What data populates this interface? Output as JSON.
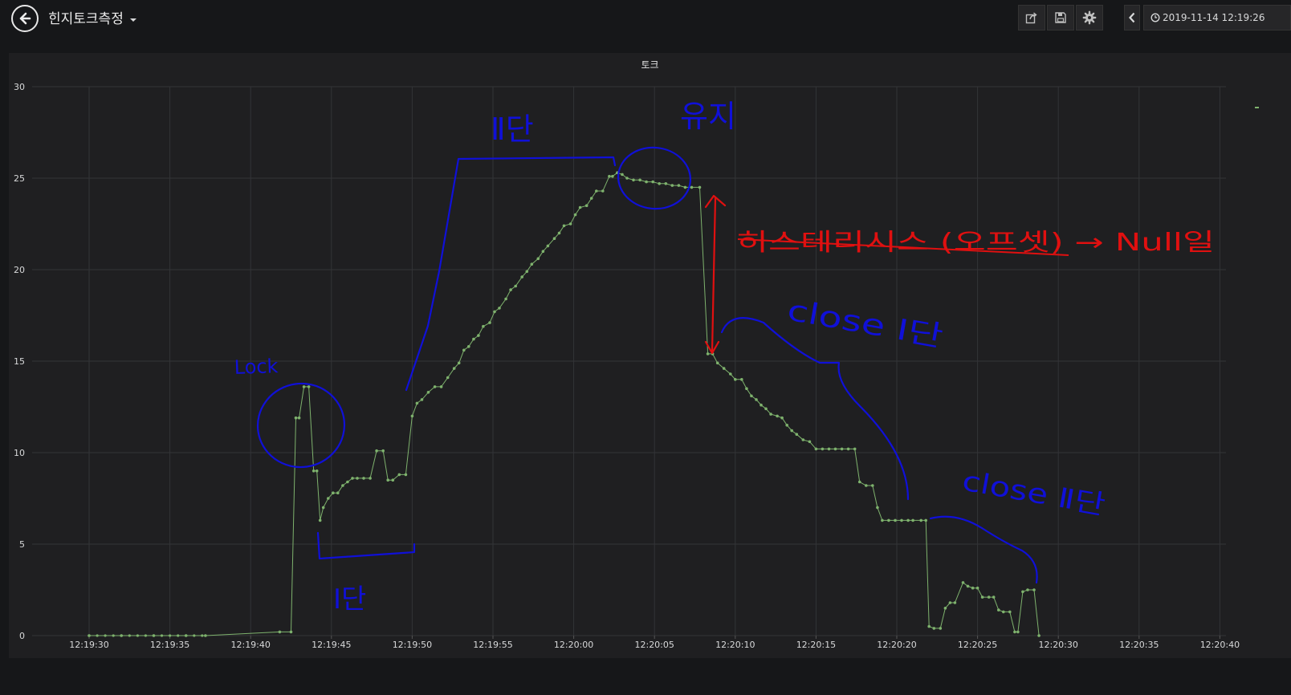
{
  "header": {
    "dashboard_title": "힌지토크측정",
    "time_range": "2019-11-14 12:19:26"
  },
  "icons": {
    "back": "arrow-left-circle-icon",
    "share": "share-icon",
    "save": "save-icon",
    "settings": "gear-icon",
    "time_back": "chevron-left-icon",
    "clock": "clock-icon"
  },
  "colors": {
    "series": "#7eb26d",
    "annotation_blue": "#1010d8",
    "annotation_red": "#e01010",
    "grid": "#333437"
  },
  "panel": {
    "title": "토크"
  },
  "chart_data": {
    "type": "line",
    "title": "토크",
    "ylim": [
      0,
      30
    ],
    "y_ticks": [
      "0",
      "5",
      "10",
      "15",
      "20",
      "25",
      "30"
    ],
    "x_ticks": [
      "12:19:30",
      "12:19:35",
      "12:19:40",
      "12:19:45",
      "12:19:50",
      "12:19:55",
      "12:20:00",
      "12:20:05",
      "12:20:10",
      "12:20:15",
      "12:20:20",
      "12:20:25",
      "12:20:30",
      "12:20:35",
      "12:20:40"
    ],
    "grid": true,
    "series": [
      {
        "name": "",
        "color": "#7eb26d",
        "points": [
          [
            "12:19:30.0",
            0
          ],
          [
            "12:19:32.0",
            0
          ],
          [
            "12:19:34.0",
            0
          ],
          [
            "12:19:36.0",
            0
          ],
          [
            "12:19:37.2",
            0
          ],
          [
            "12:19:41.8",
            0.2
          ],
          [
            "12:19:42.5",
            0.2
          ],
          [
            "12:19:42.8",
            11.9
          ],
          [
            "12:19:43.0",
            11.9
          ],
          [
            "12:19:43.3",
            13.6
          ],
          [
            "12:19:43.6",
            13.6
          ],
          [
            "12:19:43.9",
            9.0
          ],
          [
            "12:19:44.1",
            9.0
          ],
          [
            "12:19:44.3",
            6.3
          ],
          [
            "12:19:44.5",
            7.0
          ],
          [
            "12:19:44.8",
            7.5
          ],
          [
            "12:19:45.1",
            7.8
          ],
          [
            "12:19:45.4",
            7.8
          ],
          [
            "12:19:45.7",
            8.2
          ],
          [
            "12:19:46.0",
            8.4
          ],
          [
            "12:19:46.3",
            8.6
          ],
          [
            "12:19:46.6",
            8.6
          ],
          [
            "12:19:47.0",
            8.6
          ],
          [
            "12:19:47.4",
            8.6
          ],
          [
            "12:19:47.8",
            10.1
          ],
          [
            "12:19:48.2",
            10.1
          ],
          [
            "12:19:48.5",
            8.5
          ],
          [
            "12:19:48.8",
            8.5
          ],
          [
            "12:19:49.2",
            8.8
          ],
          [
            "12:19:49.6",
            8.8
          ],
          [
            "12:19:50.0",
            12.0
          ],
          [
            "12:19:50.3",
            12.7
          ],
          [
            "12:19:50.6",
            12.9
          ],
          [
            "12:19:51.0",
            13.3
          ],
          [
            "12:19:51.4",
            13.6
          ],
          [
            "12:19:51.8",
            13.6
          ],
          [
            "12:19:52.2",
            14.1
          ],
          [
            "12:19:52.6",
            14.6
          ],
          [
            "12:19:52.9",
            14.9
          ],
          [
            "12:19:53.2",
            15.6
          ],
          [
            "12:19:53.5",
            15.8
          ],
          [
            "12:19:53.8",
            16.2
          ],
          [
            "12:19:54.1",
            16.4
          ],
          [
            "12:19:54.4",
            16.9
          ],
          [
            "12:19:54.8",
            17.1
          ],
          [
            "12:19:55.1",
            17.7
          ],
          [
            "12:19:55.4",
            17.9
          ],
          [
            "12:19:55.8",
            18.4
          ],
          [
            "12:19:56.1",
            18.9
          ],
          [
            "12:19:56.4",
            19.1
          ],
          [
            "12:19:56.8",
            19.6
          ],
          [
            "12:19:57.1",
            19.9
          ],
          [
            "12:19:57.4",
            20.3
          ],
          [
            "12:19:57.8",
            20.6
          ],
          [
            "12:19:58.1",
            21.0
          ],
          [
            "12:19:58.4",
            21.3
          ],
          [
            "12:19:58.8",
            21.7
          ],
          [
            "12:19:59.1",
            22.0
          ],
          [
            "12:19:59.4",
            22.4
          ],
          [
            "12:19:59.8",
            22.5
          ],
          [
            "12:20:00.1",
            23.0
          ],
          [
            "12:20:00.4",
            23.4
          ],
          [
            "12:20:00.8",
            23.5
          ],
          [
            "12:20:01.1",
            23.9
          ],
          [
            "12:20:01.4",
            24.3
          ],
          [
            "12:20:01.8",
            24.3
          ],
          [
            "12:20:02.2",
            25.1
          ],
          [
            "12:20:02.4",
            25.1
          ],
          [
            "12:20:02.7",
            25.3
          ],
          [
            "12:20:03.0",
            25.2
          ],
          [
            "12:20:03.3",
            25.0
          ],
          [
            "12:20:03.7",
            24.9
          ],
          [
            "12:20:04.1",
            24.9
          ],
          [
            "12:20:04.5",
            24.8
          ],
          [
            "12:20:04.9",
            24.8
          ],
          [
            "12:20:05.3",
            24.7
          ],
          [
            "12:20:05.7",
            24.7
          ],
          [
            "12:20:06.1",
            24.6
          ],
          [
            "12:20:06.5",
            24.6
          ],
          [
            "12:20:06.9",
            24.5
          ],
          [
            "12:20:07.3",
            24.5
          ],
          [
            "12:20:07.8",
            24.5
          ],
          [
            "12:20:08.3",
            15.4
          ],
          [
            "12:20:08.6",
            15.4
          ],
          [
            "12:20:08.9",
            14.9
          ],
          [
            "12:20:09.3",
            14.6
          ],
          [
            "12:20:09.7",
            14.3
          ],
          [
            "12:20:10.0",
            14.0
          ],
          [
            "12:20:10.4",
            14.0
          ],
          [
            "12:20:10.7",
            13.5
          ],
          [
            "12:20:11.0",
            13.1
          ],
          [
            "12:20:11.3",
            12.9
          ],
          [
            "12:20:11.6",
            12.6
          ],
          [
            "12:20:11.9",
            12.4
          ],
          [
            "12:20:12.2",
            12.1
          ],
          [
            "12:20:12.6",
            12.0
          ],
          [
            "12:20:12.9",
            11.9
          ],
          [
            "12:20:13.2",
            11.5
          ],
          [
            "12:20:13.5",
            11.2
          ],
          [
            "12:20:13.8",
            11.0
          ],
          [
            "12:20:14.2",
            10.7
          ],
          [
            "12:20:14.6",
            10.6
          ],
          [
            "12:20:15.0",
            10.2
          ],
          [
            "12:20:15.4",
            10.2
          ],
          [
            "12:20:15.8",
            10.2
          ],
          [
            "12:20:16.2",
            10.2
          ],
          [
            "12:20:16.6",
            10.2
          ],
          [
            "12:20:17.0",
            10.2
          ],
          [
            "12:20:17.4",
            10.2
          ],
          [
            "12:20:17.7",
            8.4
          ],
          [
            "12:20:18.1",
            8.2
          ],
          [
            "12:20:18.5",
            8.2
          ],
          [
            "12:20:18.8",
            7.0
          ],
          [
            "12:20:19.1",
            6.3
          ],
          [
            "12:20:19.5",
            6.3
          ],
          [
            "12:20:19.9",
            6.3
          ],
          [
            "12:20:20.3",
            6.3
          ],
          [
            "12:20:20.7",
            6.3
          ],
          [
            "12:20:21.0",
            6.3
          ],
          [
            "12:20:21.5",
            6.3
          ],
          [
            "12:20:21.8",
            6.3
          ],
          [
            "12:20:22.0",
            0.5
          ],
          [
            "12:20:22.3",
            0.4
          ],
          [
            "12:20:22.7",
            0.4
          ],
          [
            "12:20:23.0",
            1.5
          ],
          [
            "12:20:23.3",
            1.8
          ],
          [
            "12:20:23.6",
            1.8
          ],
          [
            "12:20:24.1",
            2.9
          ],
          [
            "12:20:24.4",
            2.7
          ],
          [
            "12:20:24.7",
            2.6
          ],
          [
            "12:20:25.0",
            2.6
          ],
          [
            "12:20:25.3",
            2.1
          ],
          [
            "12:20:25.7",
            2.1
          ],
          [
            "12:20:26.0",
            2.1
          ],
          [
            "12:20:26.3",
            1.4
          ],
          [
            "12:20:26.6",
            1.3
          ],
          [
            "12:20:27.0",
            1.3
          ],
          [
            "12:20:27.3",
            0.2
          ],
          [
            "12:20:27.5",
            0.2
          ],
          [
            "12:20:27.8",
            2.4
          ],
          [
            "12:20:28.1",
            2.5
          ],
          [
            "12:20:28.5",
            2.5
          ],
          [
            "12:20:28.8",
            0
          ]
        ]
      }
    ],
    "annotations": [
      {
        "text": "Lock",
        "color": "#1010d8"
      },
      {
        "text": "Ⅰ단",
        "color": "#1010d8"
      },
      {
        "text": "Ⅱ단",
        "color": "#1010d8"
      },
      {
        "text": "유지",
        "color": "#1010d8"
      },
      {
        "text": "히스테리시스 (오프셋) → Null일",
        "color": "#e01010"
      },
      {
        "text": "close Ⅰ단",
        "color": "#1010d8"
      },
      {
        "text": "close Ⅱ단",
        "color": "#1010d8"
      }
    ]
  }
}
